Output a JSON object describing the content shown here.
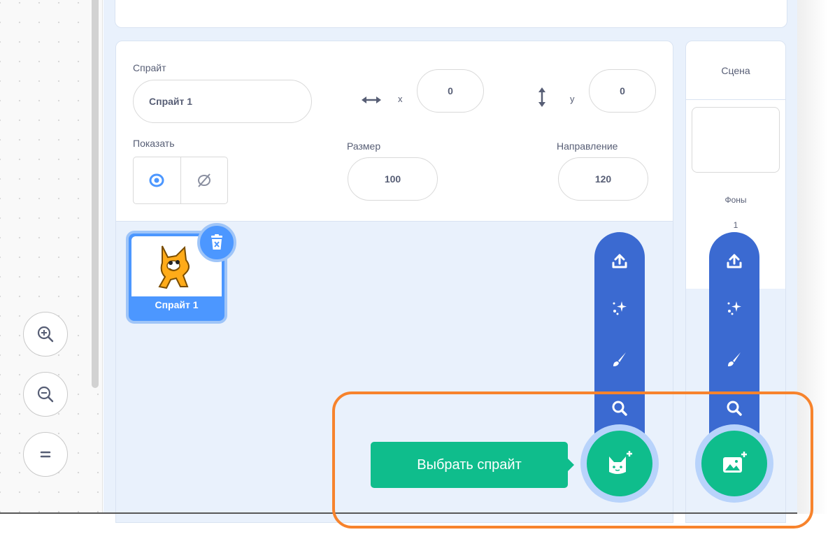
{
  "workspace": {
    "zoom_in": "zoom-in",
    "zoom_out": "zoom-out",
    "zoom_reset": "zoom-reset"
  },
  "sprite_info": {
    "sprite_label": "Спрайт",
    "sprite_name": "Спрайт 1",
    "x_label": "x",
    "x_value": "0",
    "y_label": "y",
    "y_value": "0",
    "show_label": "Показать",
    "size_label": "Размер",
    "size_value": "100",
    "direction_label": "Направление",
    "direction_value": "120"
  },
  "sprite_list": {
    "items": [
      {
        "name": "Спрайт 1",
        "selected": true
      }
    ]
  },
  "sprite_menu": {
    "items": [
      "upload-icon",
      "surprise-icon",
      "paint-icon",
      "search-icon"
    ],
    "main_icon": "cat-add-icon",
    "tooltip": "Выбрать спрайт"
  },
  "stage_pane": {
    "title": "Сцена",
    "backdrops_label": "Фоны",
    "backdrops_count": "1",
    "menu_items": [
      "upload-icon",
      "surprise-icon",
      "paint-icon",
      "search-icon"
    ],
    "main_icon": "backdrop-add-icon"
  },
  "colors": {
    "accent_blue": "#4c97ff",
    "menu_blue": "#3b6ad1",
    "green": "#0fbd8c",
    "highlight_orange": "#f7832c",
    "text": "#575e75",
    "panel_bg": "#e9f1fc"
  }
}
